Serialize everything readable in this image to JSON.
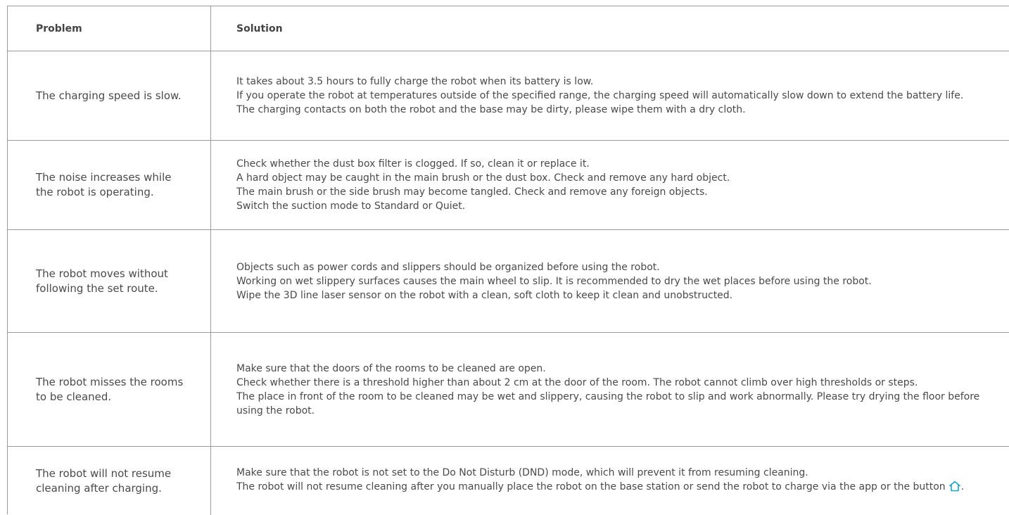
{
  "header": {
    "problem": "Problem",
    "solution": "Solution"
  },
  "rows": [
    {
      "problem": "The charging speed is slow.",
      "solutions": [
        "It takes about 3.5 hours to fully charge the robot when its battery is low.",
        "If you operate the robot at temperatures outside of the specified range, the charging speed will automatically slow down to extend the battery life.",
        "The charging contacts on both the robot and the base may be dirty, please wipe them with a dry cloth."
      ]
    },
    {
      "problem": "The noise increases while the robot is operating.",
      "solutions": [
        "Check whether the dust box filter is clogged. If so, clean it or replace it.",
        "A hard object may be caught in the main brush or the dust box. Check and remove any hard object.",
        "The main brush or the side brush may become tangled. Check and remove any foreign objects.",
        "Switch the suction mode to Standard or Quiet."
      ]
    },
    {
      "problem": "The robot moves without following the set route.",
      "solutions": [
        "Objects such as power cords and slippers should be organized before using the robot.",
        "Working on wet slippery surfaces causes the main wheel to slip. It is recommended to dry the wet places before using the robot.",
        "Wipe the 3D line laser sensor on the robot with a clean, soft cloth to keep it clean and unobstructed."
      ]
    },
    {
      "problem": "The robot misses the rooms to be cleaned.",
      "solutions": [
        "Make sure that the doors of the rooms to be cleaned are open.",
        "Check whether there is a threshold higher than about 2 cm at the door of the room. The robot cannot climb over high thresholds or steps.",
        "The place in front of the room to be cleaned may be wet and slippery, causing the robot to slip and work abnormally. Please try drying the floor before using the robot."
      ]
    },
    {
      "problem": "The robot will not resume cleaning after charging.",
      "solutions": [
        "Make sure that the robot is not set to the Do Not Disturb (DND) mode, which will prevent it from resuming cleaning.",
        "The robot will not resume cleaning after you manually place the robot on the base station or send the robot to charge via the app or the button",
        "."
      ]
    }
  ],
  "icons": {
    "home": "home-icon"
  },
  "colors": {
    "accent": "#1aa3c8",
    "border": "#9a9a9a",
    "text": "#4a4a4a"
  }
}
